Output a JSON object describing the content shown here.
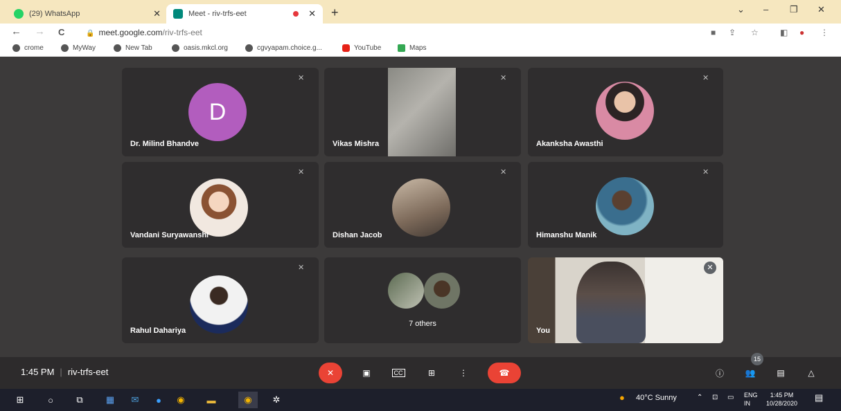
{
  "browser": {
    "tabs": [
      {
        "title": "(29) WhatsApp"
      },
      {
        "title": "Meet - riv-trfs-eet"
      }
    ],
    "new_tab": "+",
    "window_controls": {
      "chevron": "⌄",
      "minimize": "–",
      "restore": "❐",
      "close": "✕"
    },
    "nav": {
      "back": "←",
      "forward": "→",
      "reload": "C"
    },
    "url": {
      "host": "meet.google.com",
      "path": "/riv-trfs-eet"
    },
    "bookmarks": [
      "crome",
      "MyWay",
      "New Tab",
      "oasis.mkcl.org",
      "cgvyapam.choice.g...",
      "YouTube",
      "Maps"
    ]
  },
  "meet": {
    "participants": [
      {
        "name": "Dr. Milind Bhandve",
        "avatar_letter": "D"
      },
      {
        "name": "Vikas Mishra"
      },
      {
        "name": "Akanksha Awasthi"
      },
      {
        "name": "Vandani Suryawanshi"
      },
      {
        "name": "Dishan Jacob"
      },
      {
        "name": "Himanshu Manik"
      },
      {
        "name": "Rahul Dahariya"
      },
      {
        "name": "7 others"
      },
      {
        "name": "You"
      }
    ],
    "time": "1:45 PM",
    "meeting_code": "riv-trfs-eet",
    "people_count": "15"
  },
  "taskbar": {
    "weather": "40°C  Sunny",
    "lang": "ENG",
    "region": "IN",
    "time": "1:45 PM",
    "date": "10/28/2020"
  },
  "colors": {
    "end_call": "#ea4335",
    "avatar_d": "#b25dbe",
    "tabbar": "#f6e7bf"
  }
}
